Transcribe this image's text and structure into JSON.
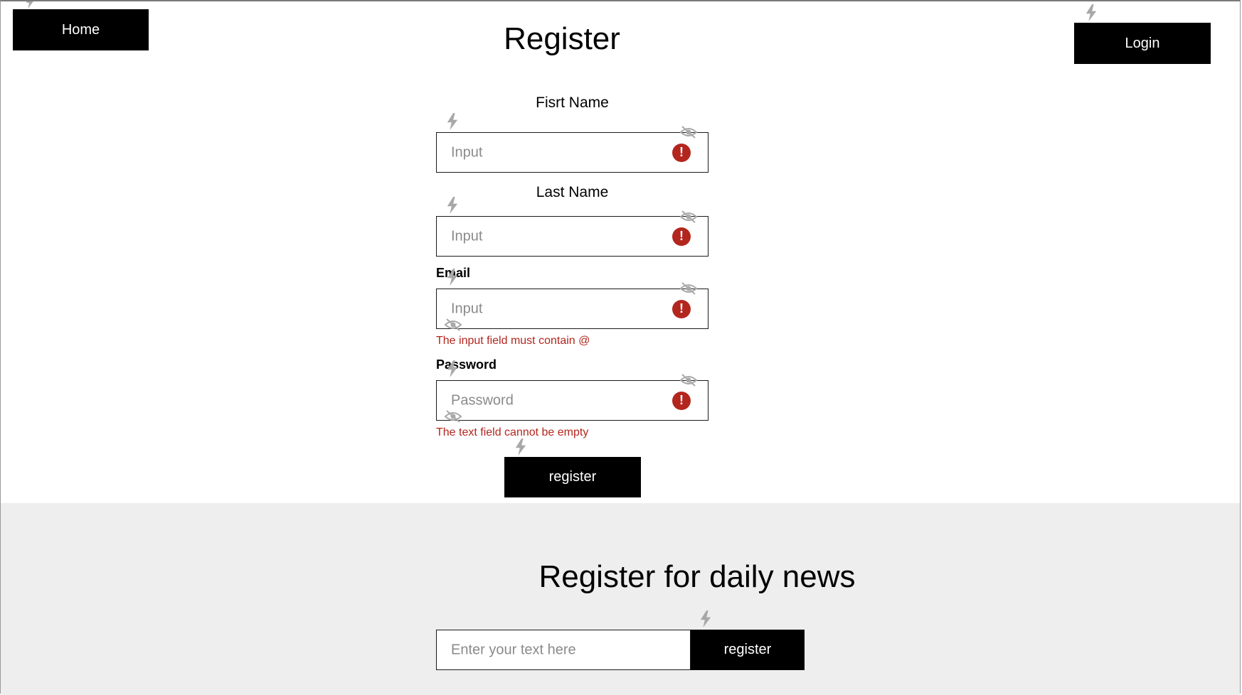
{
  "header": {
    "home_label": "Home",
    "login_label": "Login",
    "title": "Register"
  },
  "form": {
    "first_name": {
      "label": "Fisrt Name",
      "placeholder": "Input"
    },
    "last_name": {
      "label": "Last Name",
      "placeholder": "Input"
    },
    "email": {
      "label": "Email",
      "placeholder": "Input",
      "error": "The input field must contain @"
    },
    "password": {
      "label": "Password",
      "placeholder": "Password",
      "error": "The text field cannot be empty"
    },
    "error_icon_glyph": "!",
    "submit_label": "register"
  },
  "newsletter": {
    "title": "Register for daily news",
    "placeholder": "Enter your text here",
    "submit_label": "register"
  },
  "colors": {
    "button_bg": "#000000",
    "error": "#b3261e",
    "footer_bg": "#eeeeee",
    "overlay_icon": "#a8a8a8"
  },
  "icons": {
    "overlay": [
      "lightning-icon",
      "eye-off-icon"
    ],
    "error": "exclamation-circle-icon"
  }
}
